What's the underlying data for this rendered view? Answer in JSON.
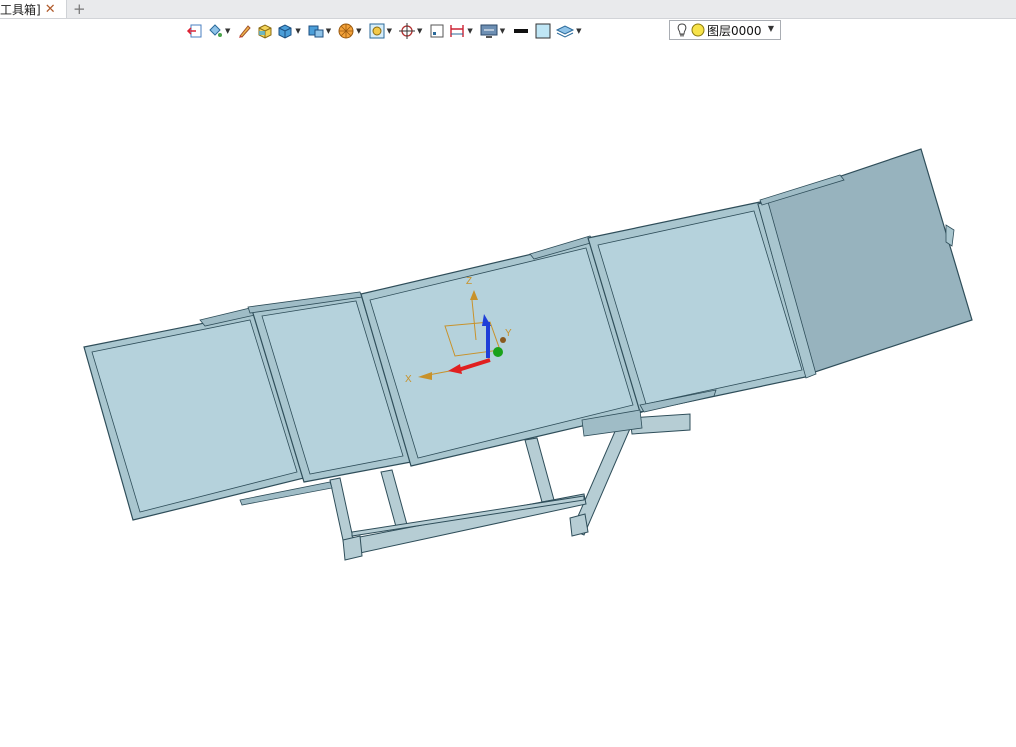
{
  "tab": {
    "label": "工具箱]",
    "close": "✕",
    "add": "+"
  },
  "toolbar": {
    "icons": [
      "exit-icon",
      "paint-bucket-icon",
      "pencil-icon",
      "cube-yellow-icon",
      "cube-blue-icon",
      "blocks-icon",
      "star-tool-icon",
      "render-box-icon",
      "crosshair-icon",
      "square-frame-icon",
      "dimension-icon",
      "monitor-icon",
      "line-weight-icon",
      "fill-color-icon",
      "layer-stack-icon"
    ]
  },
  "layer_select": {
    "value": "图层0000"
  },
  "colors": {
    "panel_fill": "#b5d2dc",
    "panel_dark": "#97b3be",
    "edge": "#2f4e5a",
    "frame": "#a9c6cf",
    "axis_x": "#e02020",
    "axis_z": "#1f3fd8",
    "axis_y": "#1aa21a",
    "axis_label": "#c8922a"
  },
  "axis_labels": {
    "x": "X",
    "y": "Y",
    "z": "Z"
  }
}
